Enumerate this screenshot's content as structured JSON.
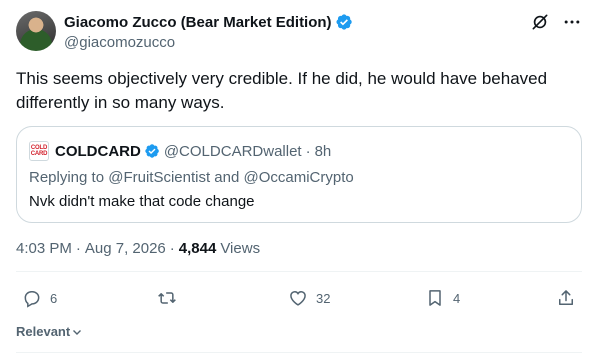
{
  "author": {
    "display_name": "Giacomo Zucco (Bear Market Edition)",
    "handle": "@giacomozucco"
  },
  "tweet": {
    "text": "This seems objectively very credible. If he did, he would have behaved differently in so many ways."
  },
  "quote": {
    "logo_line1": "COLD",
    "logo_line2": "CARD",
    "name": "COLDCARD",
    "handle": "@COLDCARDwallet",
    "separator": "·",
    "time": "8h",
    "reply_context": "Replying to @FruitScientist and @OccamiCrypto",
    "text": "Nvk didn't make that code change"
  },
  "meta": {
    "time": "4:03 PM",
    "dot": "·",
    "date": "Aug 7, 2026",
    "views_count": "4,844",
    "views_label": "Views"
  },
  "actions": {
    "replies": "6",
    "retweets": "",
    "likes": "32",
    "bookmarks": "4"
  },
  "sort": {
    "label": "Relevant"
  },
  "colors": {
    "verified_blue": "#1d9bf0",
    "secondary_text": "#536471",
    "primary_text": "#0f1419",
    "border": "#cfd9de",
    "coldcard_red": "#d21f2b"
  },
  "icons": [
    "verified-badge-icon",
    "grok-icon",
    "more-icon",
    "reply-icon",
    "retweet-icon",
    "like-icon",
    "bookmark-icon",
    "share-icon",
    "chevron-down-icon"
  ]
}
